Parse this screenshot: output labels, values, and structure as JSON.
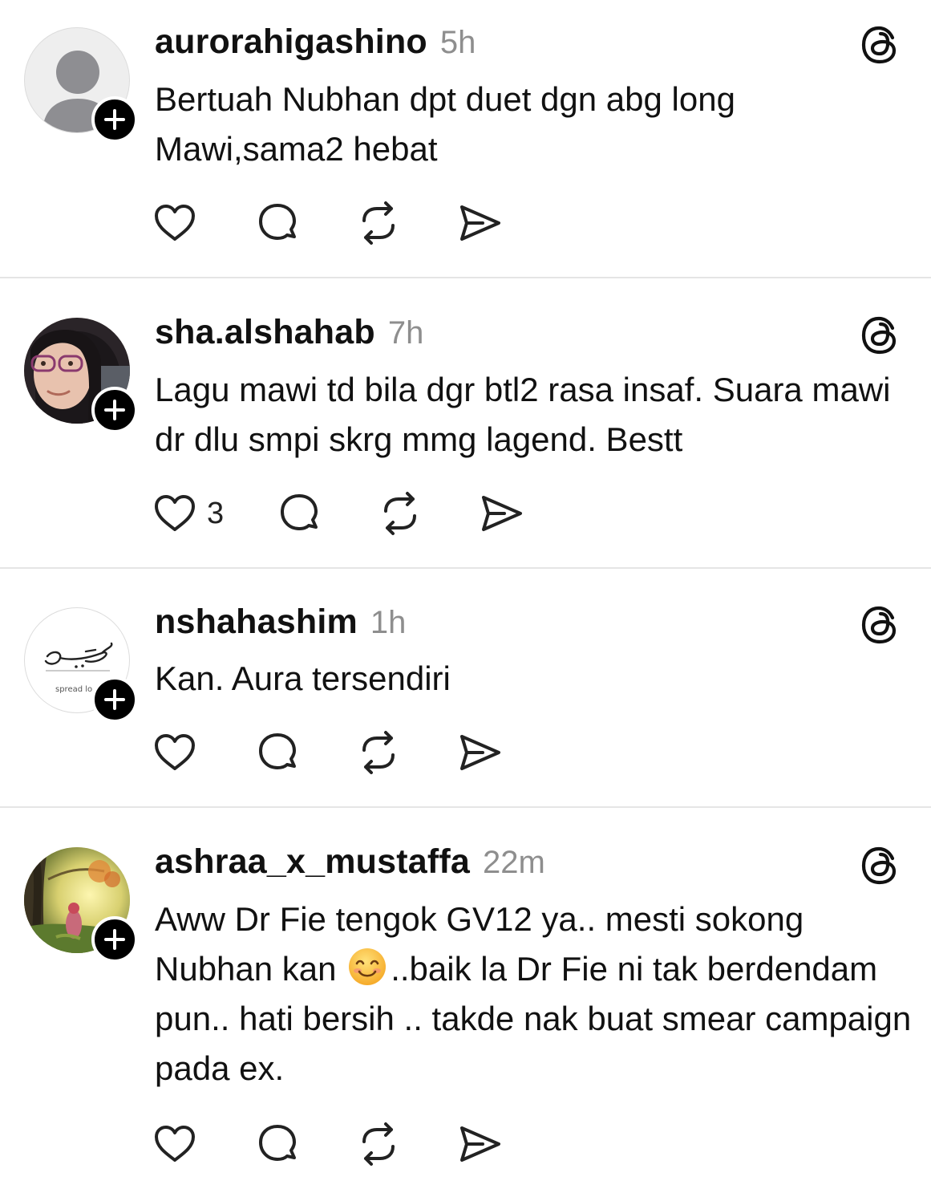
{
  "posts": [
    {
      "username": "aurorahigashino",
      "time": "5h",
      "text": "Bertuah Nubhan dpt duet dgn abg long Mawi,sama2 hebat",
      "like_count": "",
      "avatar": "default-avatar"
    },
    {
      "username": "sha.alshahab",
      "time": "7h",
      "text": "Lagu mawi td bila dgr btl2 rasa insaf. Suara mawi dr dlu smpi skrg mmg lagend. Bestt",
      "like_count": "3",
      "avatar": "photo-avatar-hijab-glasses"
    },
    {
      "username": "nshahashim",
      "time": "1h",
      "text": "Kan. Aura tersendiri",
      "like_count": "",
      "avatar": "calligraphy-logo-avatar",
      "avatar_text": "spread lo"
    },
    {
      "username": "ashraa_x_mustaffa",
      "time": "22m",
      "text_before_emoji": "Aww Dr Fie tengok GV12 ya.. mesti sokong Nubhan kan ",
      "text_after_emoji": "..baik la Dr Fie ni tak berdendam pun.. hati bersih .. takde nak buat smear campaign pada ex.",
      "like_count": "",
      "avatar": "illustration-avatar-forest",
      "emoji": "smiling-face-emoji"
    }
  ],
  "icons": {
    "follow": "plus-icon",
    "platform": "threads-logo-icon",
    "like": "heart-icon",
    "reply": "comment-bubble-icon",
    "repost": "repost-icon",
    "share": "send-icon"
  },
  "colors": {
    "text": "#111111",
    "meta": "#8e8e8e",
    "divider": "#e5e5e5",
    "badge": "#000000"
  }
}
